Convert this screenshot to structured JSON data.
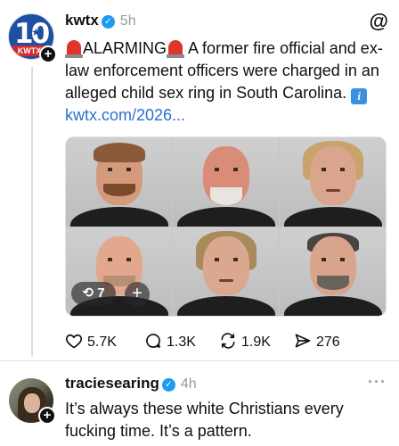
{
  "post1": {
    "avatar_logo": "10",
    "avatar_logo_sub": "KWTX",
    "username": "kwtx",
    "time": "5h",
    "alarm_word": "ALARMING",
    "body": "A former fire official and ex-law enforcement officers were charged in an alleged child sex ring in South Carolina.",
    "link_text": "kwtx.com/2026...",
    "info_glyph": "i",
    "photo_grid": {
      "repost_count": "7",
      "add_label": "+"
    },
    "actions": {
      "likes": "5.7K",
      "replies": "1.3K",
      "reposts": "1.9K",
      "shares": "276"
    }
  },
  "post2": {
    "username": "traciesearing",
    "time": "4h",
    "more": "···",
    "body": "It’s always these white Christians every fucking time. It’s a pattern."
  },
  "icons": {
    "threads_logo": "@",
    "verified_check": "✓",
    "plus": "+",
    "repost_glyph": "⟲"
  },
  "colors": {
    "link": "#2b6fcf",
    "verified": "#1d9bf0",
    "muted": "#999999",
    "siren_red": "#e0352b"
  }
}
